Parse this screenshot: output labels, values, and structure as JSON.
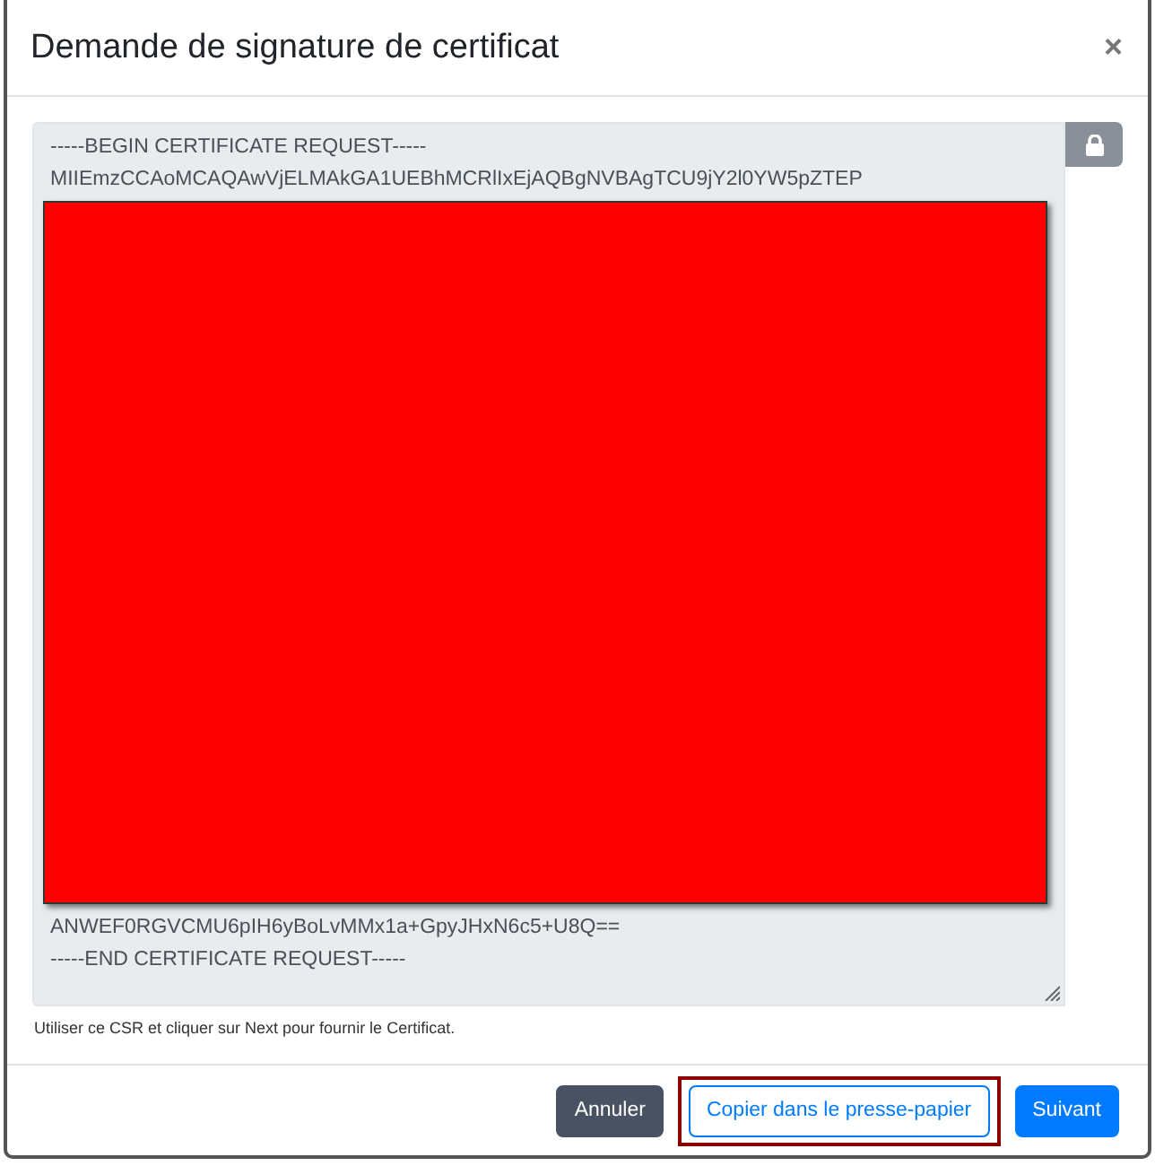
{
  "dialog": {
    "title": "Demande de signature de certificat",
    "close": "×"
  },
  "csr": {
    "lines_before": [
      "-----BEGIN CERTIFICATE REQUEST-----",
      "MIIEmzCCAoMCAQAwVjELMAkGA1UEBhMCRlIxEjAQBgNVBAgTCU9jY2l0YW5pZTEP"
    ],
    "redacted": true,
    "lines_after": [
      "ANWEF0RGVCMU6pIH6yBoLvMMx1a+GpyJHxN6c5+U8Q==",
      "-----END CERTIFICATE REQUEST-----"
    ]
  },
  "help": "Utiliser ce CSR et cliquer sur Next pour fournir le Certificat.",
  "buttons": [
    {
      "label": "Annuler",
      "kind": "secondary",
      "highlighted": false
    },
    {
      "label": "Copier dans le presse-papier",
      "kind": "outline",
      "highlighted": true
    },
    {
      "label": "Suivant",
      "kind": "primary",
      "highlighted": false
    }
  ]
}
